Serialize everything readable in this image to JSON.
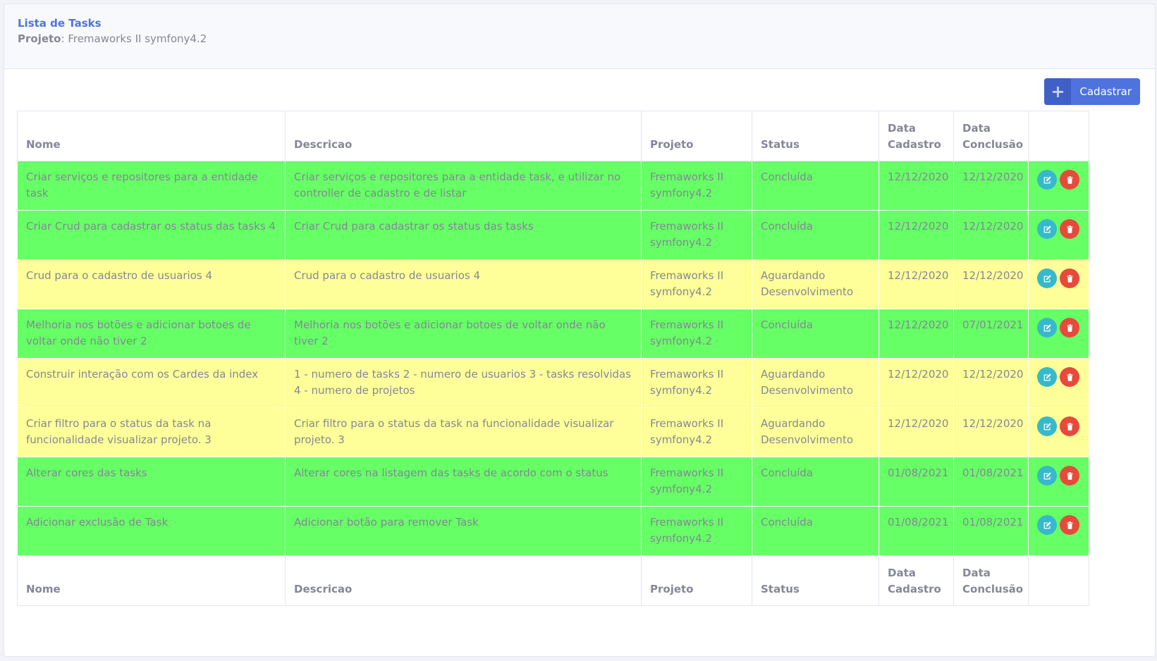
{
  "header": {
    "title": "Lista de Tasks",
    "project_label": "Projeto",
    "project_value": "Fremaworks II symfony4.2"
  },
  "toolbar": {
    "add_label": "Cadastrar",
    "add_icon": "plus-icon"
  },
  "table": {
    "columns": [
      "Nome",
      "Descricao",
      "Projeto",
      "Status",
      "Data Cadastro",
      "Data Conclusão",
      ""
    ],
    "rows": [
      {
        "nome": "Criar serviços e repositores para a entidade task",
        "descricao": "Criar serviços e repositores para a entidade task, e utilizar no controller de cadastro e de listar",
        "projeto": "Fremaworks II symfony4.2",
        "status": "Concluída",
        "data_cadastro": "12/12/2020",
        "data_conclusao": "12/12/2020",
        "color": "green"
      },
      {
        "nome": "Criar Crud para cadastrar os status das tasks 4",
        "descricao": "Criar Crud para cadastrar os status das tasks",
        "projeto": "Fremaworks II symfony4.2",
        "status": "Concluída",
        "data_cadastro": "12/12/2020",
        "data_conclusao": "12/12/2020",
        "color": "green"
      },
      {
        "nome": "Crud para o cadastro de usuarios 4",
        "descricao": "Crud para o cadastro de usuarios 4",
        "projeto": "Fremaworks II symfony4.2",
        "status": "Aguardando Desenvolvimento",
        "data_cadastro": "12/12/2020",
        "data_conclusao": "12/12/2020",
        "color": "yellow"
      },
      {
        "nome": "Melhoria nos botões e adicionar botoes de voltar onde não tiver 2",
        "descricao": "Melhoria nos botões e adicionar botoes de voltar onde não tiver 2",
        "projeto": "Fremaworks II symfony4.2",
        "status": "Concluída",
        "data_cadastro": "12/12/2020",
        "data_conclusao": "07/01/2021",
        "color": "green"
      },
      {
        "nome": "Construir interação com os Cardes da index",
        "descricao": "1 - numero de tasks 2 - numero de usuarios 3 - tasks resolvidas 4 - numero de projetos",
        "projeto": "Fremaworks II symfony4.2",
        "status": "Aguardando Desenvolvimento",
        "data_cadastro": "12/12/2020",
        "data_conclusao": "12/12/2020",
        "color": "yellow"
      },
      {
        "nome": "Criar filtro para o status da task na funcionalidade visualizar projeto. 3",
        "descricao": "Criar filtro para o status da task na funcionalidade visualizar projeto. 3",
        "projeto": "Fremaworks II symfony4.2",
        "status": "Aguardando Desenvolvimento",
        "data_cadastro": "12/12/2020",
        "data_conclusao": "12/12/2020",
        "color": "yellow"
      },
      {
        "nome": "Alterar cores das tasks",
        "descricao": "Alterar cores na listagem das tasks de acordo com o status",
        "projeto": "Fremaworks II symfony4.2",
        "status": "Concluída",
        "data_cadastro": "01/08/2021",
        "data_conclusao": "01/08/2021",
        "color": "green"
      },
      {
        "nome": "Adicionar exclusão de Task",
        "descricao": "Adicionar botão para remover Task",
        "projeto": "Fremaworks II symfony4.2",
        "status": "Concluída",
        "data_cadastro": "01/08/2021",
        "data_conclusao": "01/08/2021",
        "color": "green"
      }
    ],
    "row_actions": {
      "edit_icon": "edit-icon",
      "delete_icon": "trash-icon"
    }
  },
  "colors": {
    "accent": "#4e73df",
    "status_concluida": "#66ff66",
    "status_aguardando": "#ffff99",
    "edit_button": "#36b9cc",
    "delete_button": "#e74a3b"
  }
}
